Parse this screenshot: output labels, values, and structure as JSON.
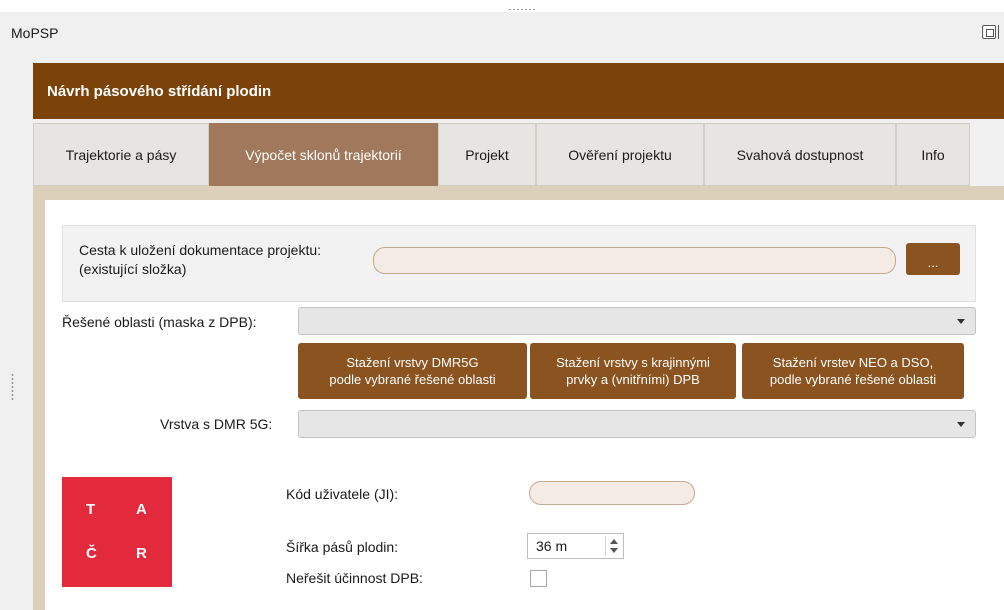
{
  "window": {
    "title": "MoPSP"
  },
  "banner": {
    "title": "Návrh pásového střídání plodin"
  },
  "tabs": [
    {
      "label": "Trajektorie a pásy",
      "active": false
    },
    {
      "label": "Výpočet sklonů trajektorií",
      "active": true
    },
    {
      "label": "Projekt",
      "active": false
    },
    {
      "label": "Ověření projektu",
      "active": false
    },
    {
      "label": "Svahová dostupnost",
      "active": false
    },
    {
      "label": "Info",
      "active": false
    }
  ],
  "doc_path": {
    "label_line1": "Cesta k uložení dokumentace projektu:",
    "label_line2": "(existující složka)",
    "value": "",
    "browse_label": "..."
  },
  "areas": {
    "label": "Řešené oblasti (maska z DPB):",
    "value": ""
  },
  "download_buttons": [
    {
      "line1": "Stažení vrstvy DMR5G",
      "line2": "podle vybrané řešené oblasti"
    },
    {
      "line1": "Stažení vrstvy s krajinnými",
      "line2": "prvky a (vnitřními) DPB"
    },
    {
      "line1": "Stažení vrstev NEO a DSO,",
      "line2": "podle vybrané řešené oblasti"
    }
  ],
  "dmr_layer": {
    "label": "Vrstva s DMR 5G:",
    "value": ""
  },
  "logo": {
    "letters": [
      "T",
      "A",
      "Č",
      "R"
    ],
    "color": "#e22a3c"
  },
  "user_code": {
    "label": "Kód uživatele (JI):",
    "value": ""
  },
  "strip_width": {
    "label": "Šířka pásů plodin:",
    "value": "36 m"
  },
  "ignore_dpb": {
    "label": "Neřešit účinnost DPB:",
    "checked": false
  },
  "colors": {
    "banner": "#7b4209",
    "button": "#8a531f",
    "active_tab": "#a0785b",
    "panel_border": "#ddd0bb"
  }
}
